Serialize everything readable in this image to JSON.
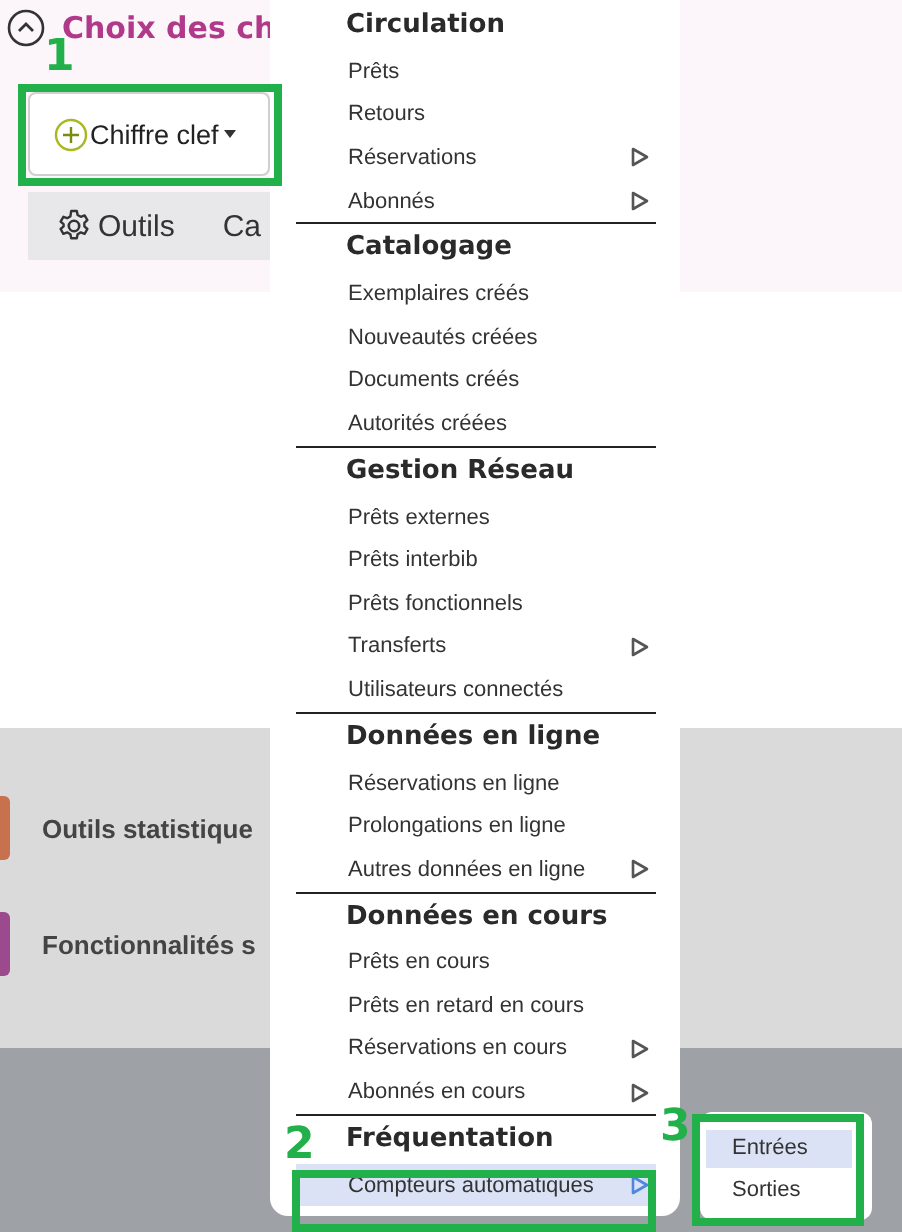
{
  "page": {
    "title": "Choix des ch",
    "add_button": "Chiffre clef",
    "tabs": [
      {
        "label": "Outils",
        "kind": "gear"
      },
      {
        "label": "Ca",
        "kind": "plain"
      }
    ],
    "cards": [
      {
        "label": "Outils statistique",
        "color": "#c8714e"
      },
      {
        "label": "Fonctionnalités s",
        "color": "#9c4a8e"
      }
    ]
  },
  "menu": {
    "sections": [
      {
        "title": "Circulation",
        "items": [
          {
            "label": "Prêts",
            "submenu": false,
            "selected": false
          },
          {
            "label": "Retours",
            "submenu": false,
            "selected": false
          },
          {
            "label": "Réservations",
            "submenu": true,
            "selected": false
          },
          {
            "label": "Abonnés",
            "submenu": true,
            "selected": false
          }
        ]
      },
      {
        "title": "Catalogage",
        "items": [
          {
            "label": "Exemplaires créés",
            "submenu": false,
            "selected": false
          },
          {
            "label": "Nouveautés créées",
            "submenu": false,
            "selected": false
          },
          {
            "label": "Documents créés",
            "submenu": false,
            "selected": false
          },
          {
            "label": "Autorités créées",
            "submenu": false,
            "selected": false
          }
        ]
      },
      {
        "title": "Gestion Réseau",
        "items": [
          {
            "label": "Prêts externes",
            "submenu": false,
            "selected": false
          },
          {
            "label": "Prêts interbib",
            "submenu": false,
            "selected": false
          },
          {
            "label": "Prêts fonctionnels",
            "submenu": false,
            "selected": false
          },
          {
            "label": "Transferts",
            "submenu": true,
            "selected": false
          },
          {
            "label": "Utilisateurs connectés",
            "submenu": false,
            "selected": false
          }
        ]
      },
      {
        "title": "Données en ligne",
        "items": [
          {
            "label": "Réservations en ligne",
            "submenu": false,
            "selected": false
          },
          {
            "label": "Prolongations en ligne",
            "submenu": false,
            "selected": false
          },
          {
            "label": "Autres données en ligne",
            "submenu": true,
            "selected": false
          }
        ]
      },
      {
        "title": "Données en cours",
        "items": [
          {
            "label": "Prêts en cours",
            "submenu": false,
            "selected": false
          },
          {
            "label": "Prêts en retard en cours",
            "submenu": false,
            "selected": false
          },
          {
            "label": "Réservations en cours",
            "submenu": true,
            "selected": false
          },
          {
            "label": "Abonnés en cours",
            "submenu": true,
            "selected": false
          }
        ]
      },
      {
        "title": "Fréquentation",
        "items": [
          {
            "label": "Compteurs automatiques",
            "submenu": true,
            "selected": true
          }
        ]
      }
    ]
  },
  "submenu": {
    "items": [
      {
        "label": "Entrées",
        "selected": true
      },
      {
        "label": "Sorties",
        "selected": false
      }
    ]
  },
  "annotations": [
    {
      "label": "1"
    },
    {
      "label": "2"
    },
    {
      "label": "3"
    }
  ]
}
